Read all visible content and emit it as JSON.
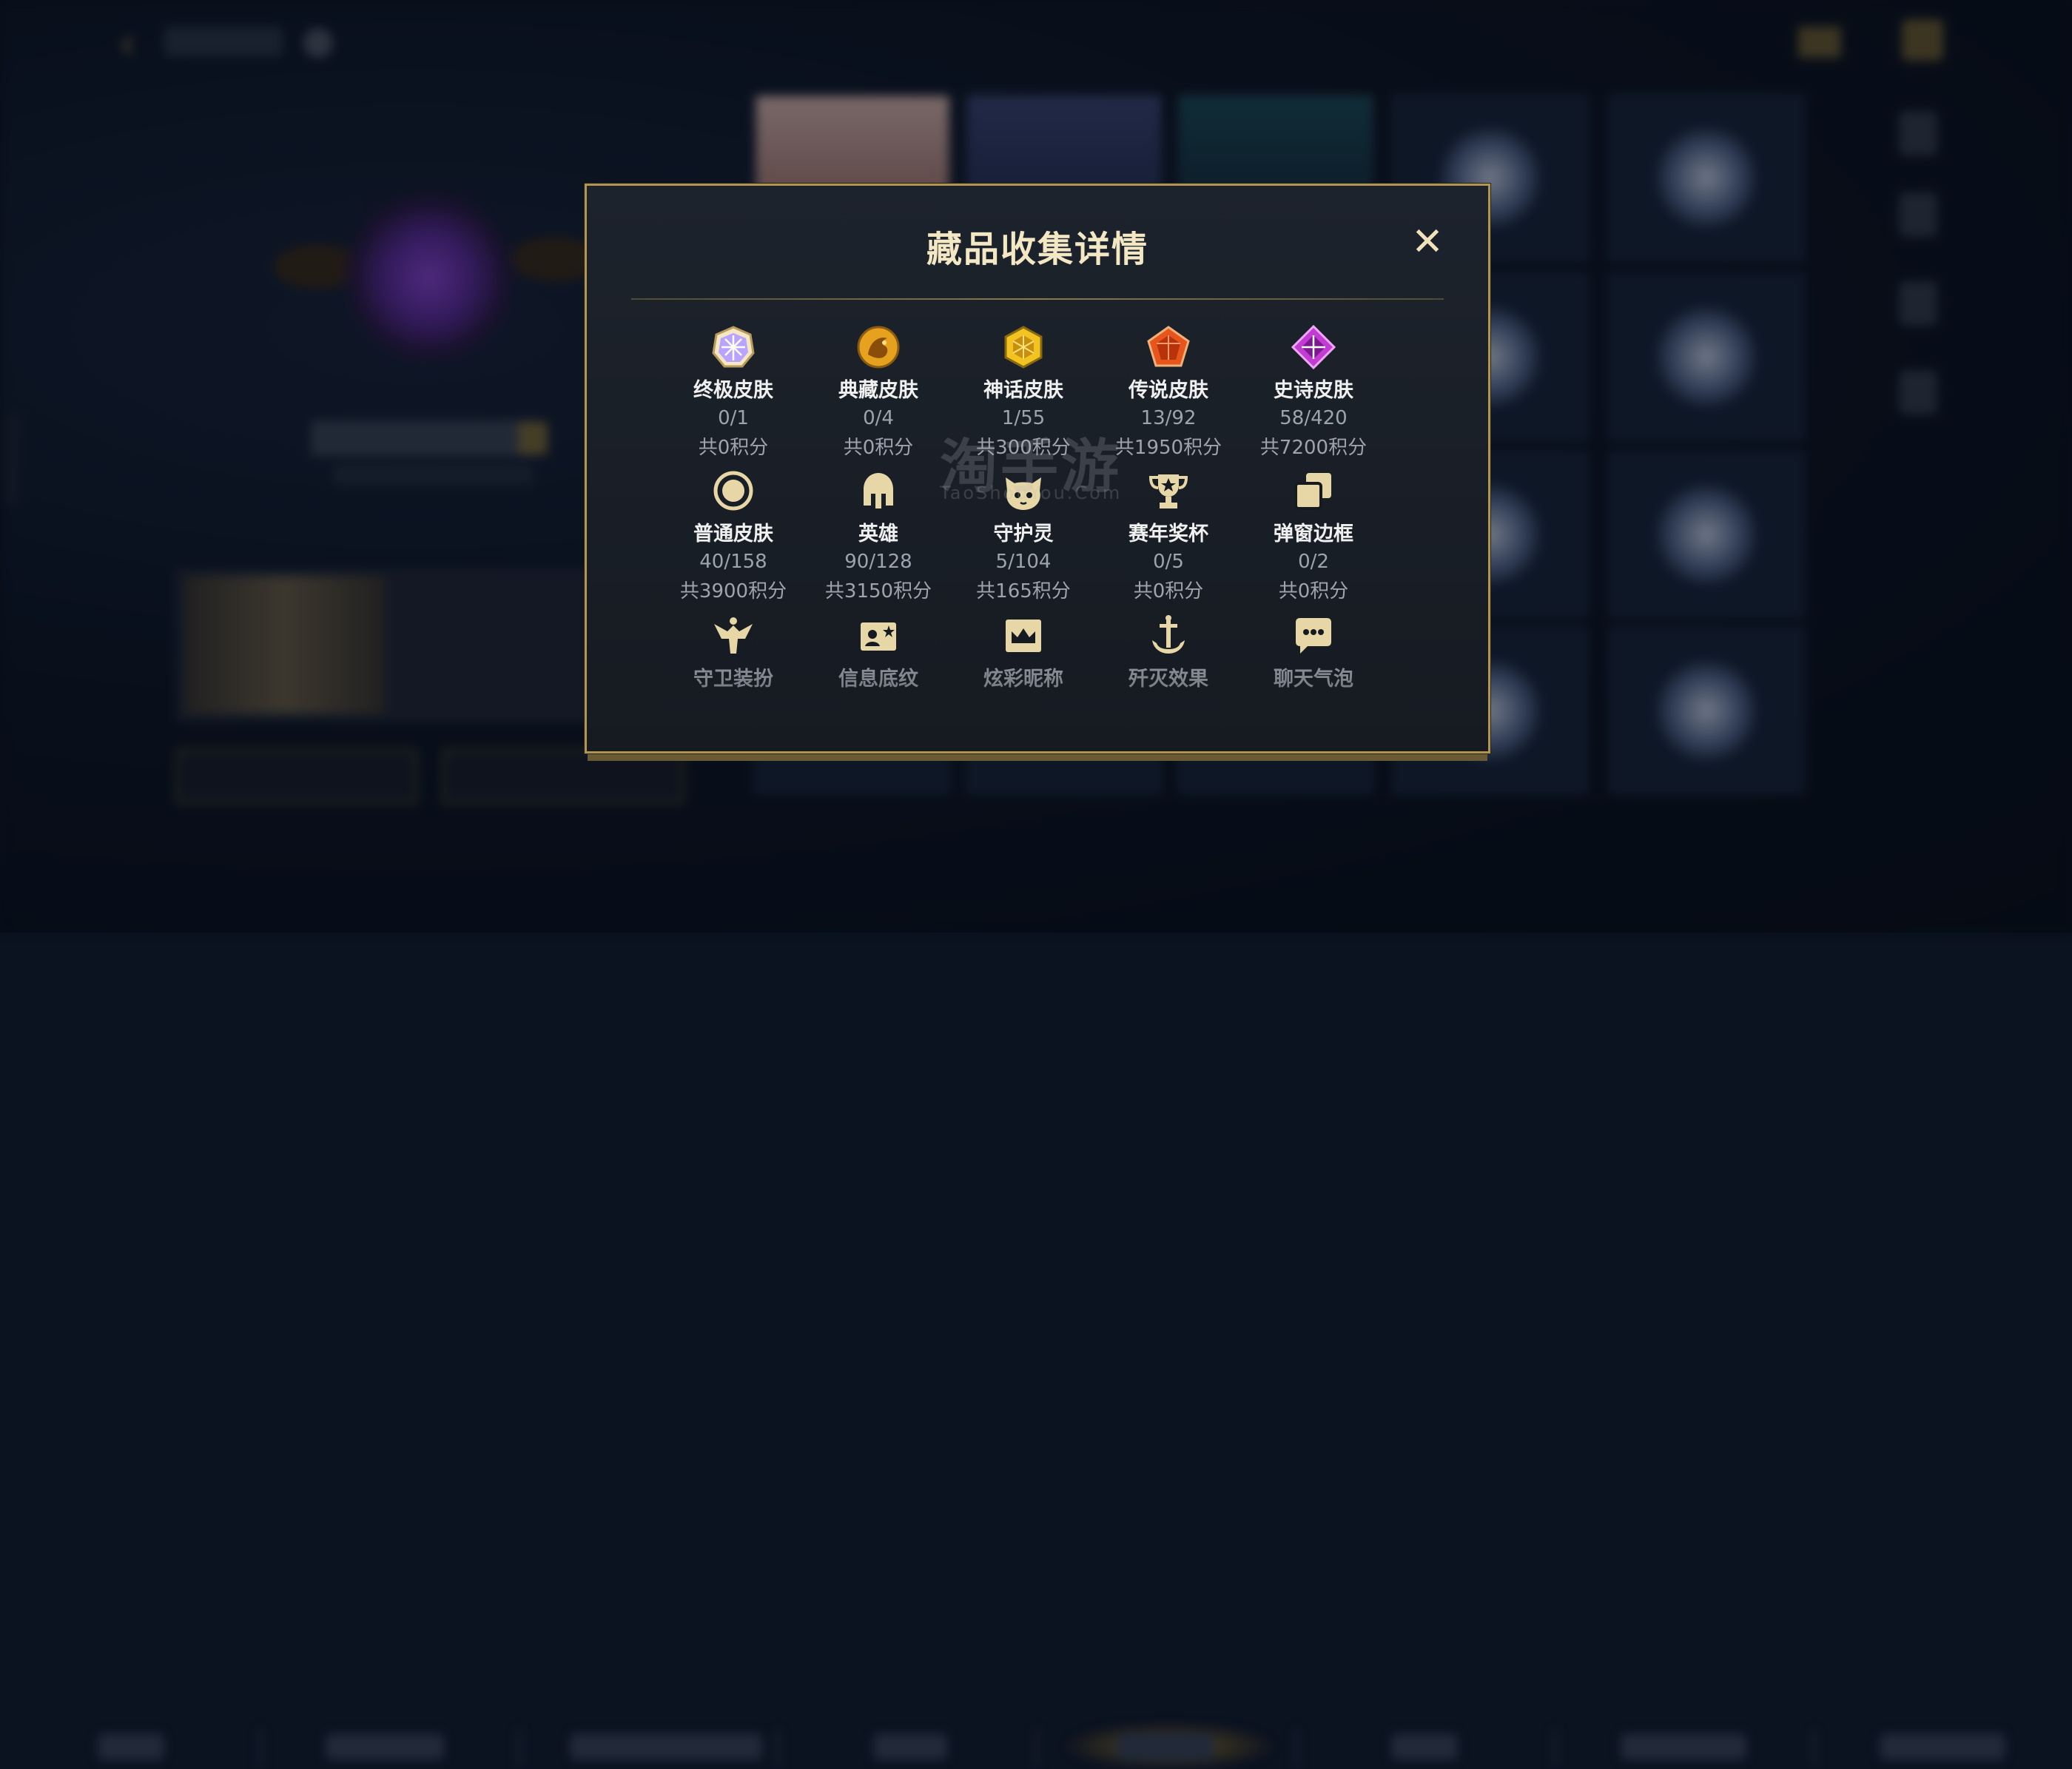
{
  "modal": {
    "title": "藏品收集详情",
    "close_glyph": "✕",
    "items": [
      {
        "label": "终极皮肤",
        "count": "0/1",
        "points": "共0积分",
        "icon": "ultimate-skin-icon",
        "color": "#b9a3ff"
      },
      {
        "label": "典藏皮肤",
        "count": "0/4",
        "points": "共0积分",
        "icon": "collector-skin-icon",
        "color": "#e6a21f"
      },
      {
        "label": "神话皮肤",
        "count": "1/55",
        "points": "共300积分",
        "icon": "mythic-skin-icon",
        "color": "#f3c322"
      },
      {
        "label": "传说皮肤",
        "count": "13/92",
        "points": "共1950积分",
        "icon": "legendary-skin-icon",
        "color": "#e5551c"
      },
      {
        "label": "史诗皮肤",
        "count": "58/420",
        "points": "共7200积分",
        "icon": "epic-skin-icon",
        "color": "#c23cd4"
      },
      {
        "label": "普通皮肤",
        "count": "40/158",
        "points": "共3900积分",
        "icon": "normal-skin-icon",
        "color": "#e8d7a6"
      },
      {
        "label": "英雄",
        "count": "90/128",
        "points": "共3150积分",
        "icon": "hero-helmet-icon",
        "color": "#e8d7a6"
      },
      {
        "label": "守护灵",
        "count": "5/104",
        "points": "共165积分",
        "icon": "guardian-spirit-icon",
        "color": "#e8d7a6"
      },
      {
        "label": "赛年奖杯",
        "count": "0/5",
        "points": "共0积分",
        "icon": "trophy-icon",
        "color": "#e8d7a6"
      },
      {
        "label": "弹窗边框",
        "count": "0/2",
        "points": "共0积分",
        "icon": "popup-frame-icon",
        "color": "#e8d7a6"
      },
      {
        "label": "守卫装扮",
        "icon": "ward-skin-icon",
        "color": "#e8d7a6"
      },
      {
        "label": "信息底纹",
        "icon": "info-background-icon",
        "color": "#e8d7a6"
      },
      {
        "label": "炫彩昵称",
        "icon": "color-nickname-icon",
        "color": "#e8d7a6"
      },
      {
        "label": "歼灭效果",
        "icon": "elimination-effect-icon",
        "color": "#e8d7a6"
      },
      {
        "label": "聊天气泡",
        "icon": "chat-bubble-icon",
        "color": "#e8d7a6"
      }
    ]
  },
  "watermark": {
    "text": "淘手游",
    "sub": "TaoShouYou.Com"
  },
  "colors": {
    "gold_border": "#b39552",
    "title": "#f3e7c4",
    "muted": "#9ea4ae"
  }
}
